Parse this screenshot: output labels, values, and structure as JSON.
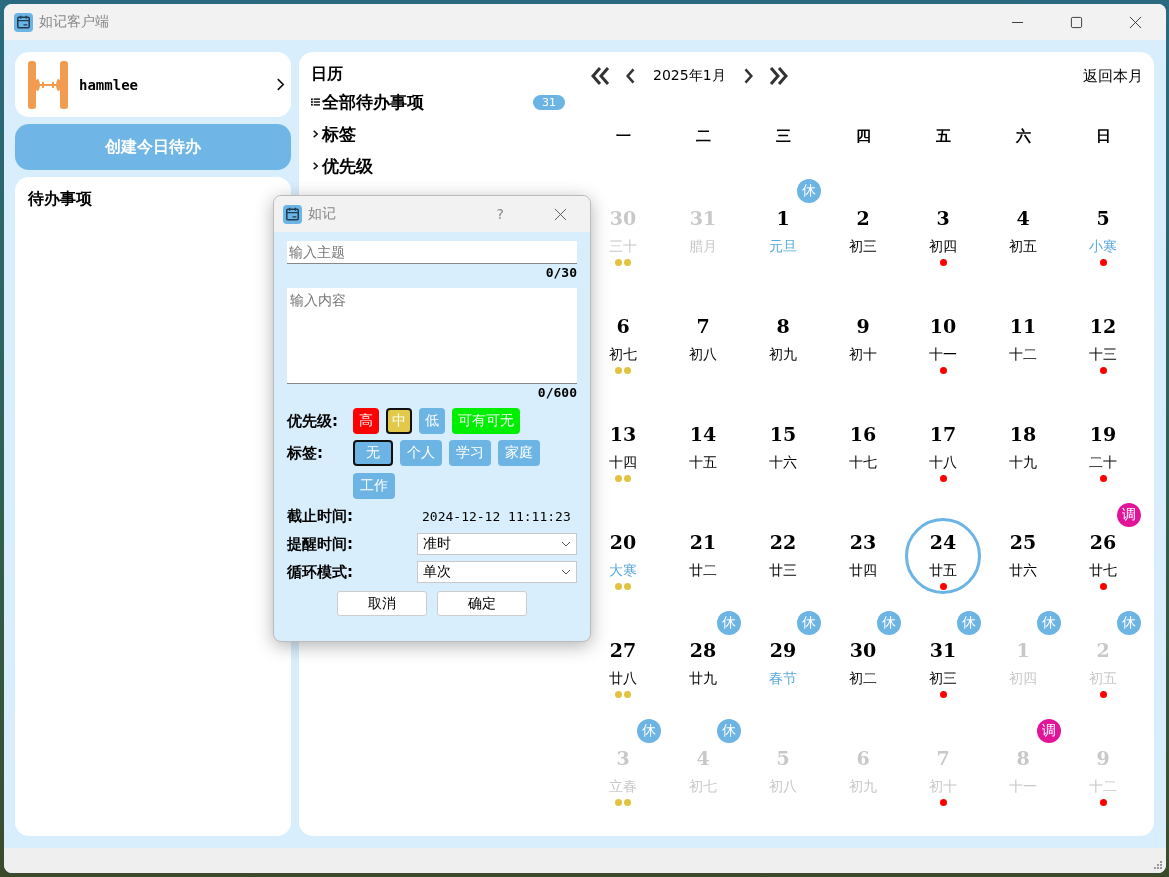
{
  "window": {
    "title": "如记客户端"
  },
  "profile": {
    "name": "hammlee"
  },
  "create_button": "创建今日待办",
  "todo_panel": {
    "title": "待办事项"
  },
  "tree": {
    "title": "日历",
    "items": [
      {
        "kind": "all",
        "label": "全部待办事项",
        "count": "31"
      },
      {
        "kind": "group",
        "label": "标签",
        "expanded": false
      },
      {
        "kind": "group",
        "label": "优先级",
        "expanded": false
      }
    ]
  },
  "calendar": {
    "month": "2025年1月",
    "back_button": "返回本月",
    "weekdays": [
      "一",
      "二",
      "三",
      "四",
      "五",
      "六",
      "日"
    ],
    "rows": [
      [
        {
          "day": "30",
          "lunar": "三十",
          "muted": true,
          "dots": [
            {
              "color": "#e2c340"
            },
            {
              "color": "#e2c340"
            }
          ]
        },
        {
          "day": "31",
          "lunar": "腊月",
          "muted": true
        },
        {
          "day": "1",
          "lunar": "元旦",
          "festival": true,
          "badge": {
            "text": "休",
            "color": "#6cb4e4"
          }
        },
        {
          "day": "2",
          "lunar": "初三"
        },
        {
          "day": "3",
          "lunar": "初四",
          "dots": [
            {
              "color": "#ff0000"
            }
          ]
        },
        {
          "day": "4",
          "lunar": "初五"
        },
        {
          "day": "5",
          "lunar": "小寒",
          "festival": true,
          "dots": [
            {
              "color": "#ff0000"
            }
          ]
        }
      ],
      [
        {
          "day": "6",
          "lunar": "初七",
          "dots": [
            {
              "color": "#e2c340"
            },
            {
              "color": "#e2c340"
            }
          ]
        },
        {
          "day": "7",
          "lunar": "初八"
        },
        {
          "day": "8",
          "lunar": "初九"
        },
        {
          "day": "9",
          "lunar": "初十"
        },
        {
          "day": "10",
          "lunar": "十一",
          "dots": [
            {
              "color": "#ff0000"
            }
          ]
        },
        {
          "day": "11",
          "lunar": "十二"
        },
        {
          "day": "12",
          "lunar": "十三",
          "dots": [
            {
              "color": "#ff0000"
            }
          ]
        }
      ],
      [
        {
          "day": "13",
          "lunar": "十四",
          "dots": [
            {
              "color": "#e2c340"
            },
            {
              "color": "#e2c340"
            }
          ]
        },
        {
          "day": "14",
          "lunar": "十五"
        },
        {
          "day": "15",
          "lunar": "十六"
        },
        {
          "day": "16",
          "lunar": "十七"
        },
        {
          "day": "17",
          "lunar": "十八",
          "dots": [
            {
              "color": "#ff0000"
            }
          ]
        },
        {
          "day": "18",
          "lunar": "十九"
        },
        {
          "day": "19",
          "lunar": "二十",
          "dots": [
            {
              "color": "#ff0000"
            }
          ]
        }
      ],
      [
        {
          "day": "20",
          "lunar": "大寒",
          "festival": true,
          "dots": [
            {
              "color": "#e2c340"
            },
            {
              "color": "#e2c340"
            }
          ]
        },
        {
          "day": "21",
          "lunar": "廿二"
        },
        {
          "day": "22",
          "lunar": "廿三"
        },
        {
          "day": "23",
          "lunar": "廿四"
        },
        {
          "day": "24",
          "lunar": "廿五",
          "today": true,
          "dots": [
            {
              "color": "#ff0000"
            }
          ]
        },
        {
          "day": "25",
          "lunar": "廿六"
        },
        {
          "day": "26",
          "lunar": "廿七",
          "badge": {
            "text": "调",
            "color": "#e0159a"
          },
          "dots": [
            {
              "color": "#ff0000"
            }
          ]
        }
      ],
      [
        {
          "day": "27",
          "lunar": "廿八",
          "dots": [
            {
              "color": "#e2c340"
            },
            {
              "color": "#e2c340"
            }
          ]
        },
        {
          "day": "28",
          "lunar": "廿九",
          "badge": {
            "text": "休",
            "color": "#6cb4e4"
          }
        },
        {
          "day": "29",
          "lunar": "春节",
          "festival": true,
          "badge": {
            "text": "休",
            "color": "#6cb4e4"
          }
        },
        {
          "day": "30",
          "lunar": "初二",
          "badge": {
            "text": "休",
            "color": "#6cb4e4"
          }
        },
        {
          "day": "31",
          "lunar": "初三",
          "badge": {
            "text": "休",
            "color": "#6cb4e4"
          },
          "dots": [
            {
              "color": "#ff0000"
            }
          ]
        },
        {
          "day": "1",
          "lunar": "初四",
          "muted": true,
          "badge": {
            "text": "休",
            "color": "#6cb4e4"
          }
        },
        {
          "day": "2",
          "lunar": "初五",
          "muted": true,
          "badge": {
            "text": "休",
            "color": "#6cb4e4"
          },
          "dots": [
            {
              "color": "#ff0000"
            }
          ]
        }
      ],
      [
        {
          "day": "3",
          "lunar": "立春",
          "muted": true,
          "badge": {
            "text": "休",
            "color": "#6cb4e4"
          },
          "dots": [
            {
              "color": "#e2c340"
            },
            {
              "color": "#e2c340"
            }
          ]
        },
        {
          "day": "4",
          "lunar": "初七",
          "muted": true,
          "badge": {
            "text": "休",
            "color": "#6cb4e4"
          }
        },
        {
          "day": "5",
          "lunar": "初八",
          "muted": true
        },
        {
          "day": "6",
          "lunar": "初九",
          "muted": true
        },
        {
          "day": "7",
          "lunar": "初十",
          "muted": true,
          "dots": [
            {
              "color": "#ff0000"
            }
          ]
        },
        {
          "day": "8",
          "lunar": "十一",
          "muted": true,
          "badge": {
            "text": "调",
            "color": "#e0159a"
          }
        },
        {
          "day": "9",
          "lunar": "十二",
          "muted": true,
          "dots": [
            {
              "color": "#ff0000"
            }
          ]
        }
      ]
    ]
  },
  "dialog": {
    "title": "如记",
    "help": "?",
    "subject": {
      "placeholder": "输入主题",
      "counter": "0/30"
    },
    "content": {
      "placeholder": "输入内容",
      "counter": "0/600"
    },
    "priority": {
      "label": "优先级:",
      "options": [
        {
          "label": "高",
          "color": "#ff0000",
          "selected": false
        },
        {
          "label": "中",
          "color": "#e2c94a",
          "selected": true
        },
        {
          "label": "低",
          "color": "#6cb4e4",
          "selected": false
        },
        {
          "label": "可有可无",
          "color": "#00ee00",
          "selected": false
        }
      ]
    },
    "tags": {
      "label": "标签:",
      "options": [
        {
          "label": "无",
          "selected": true
        },
        {
          "label": "个人",
          "selected": false
        },
        {
          "label": "学习",
          "selected": false
        },
        {
          "label": "家庭",
          "selected": false
        },
        {
          "label": "工作",
          "selected": false
        }
      ]
    },
    "deadline": {
      "label": "截止时间:",
      "value": "2024-12-12  11:11:23"
    },
    "reminder": {
      "label": "提醒时间:",
      "value": "准时"
    },
    "repeat": {
      "label": "循环模式:",
      "value": "单次"
    },
    "buttons": [
      "取消",
      "确定"
    ]
  }
}
